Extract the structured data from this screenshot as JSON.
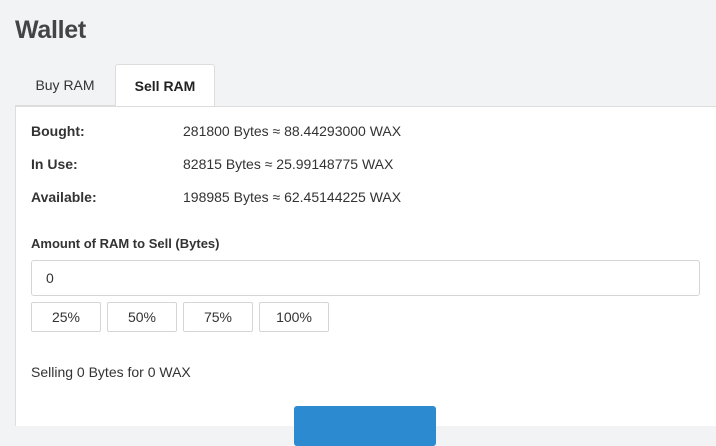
{
  "page": {
    "title": "Wallet"
  },
  "tabs": [
    {
      "label": "Buy RAM",
      "active": false
    },
    {
      "label": "Sell RAM",
      "active": true
    }
  ],
  "ram": {
    "bought": {
      "label": "Bought:",
      "value": "281800 Bytes ≈ 88.44293000 WAX"
    },
    "in_use": {
      "label": "In Use:",
      "value": "82815 Bytes ≈ 25.99148775 WAX"
    },
    "available": {
      "label": "Available:",
      "value": "198985 Bytes ≈ 62.45144225 WAX"
    }
  },
  "sell_form": {
    "amount_label": "Amount of RAM to Sell (Bytes)",
    "amount_value": "0",
    "percent_buttons": [
      "25%",
      "50%",
      "75%",
      "100%"
    ],
    "summary": "Selling 0 Bytes for 0 WAX",
    "submit_label": ""
  },
  "colors": {
    "accent": "#2b8ad0",
    "background": "#f2f3f5"
  }
}
